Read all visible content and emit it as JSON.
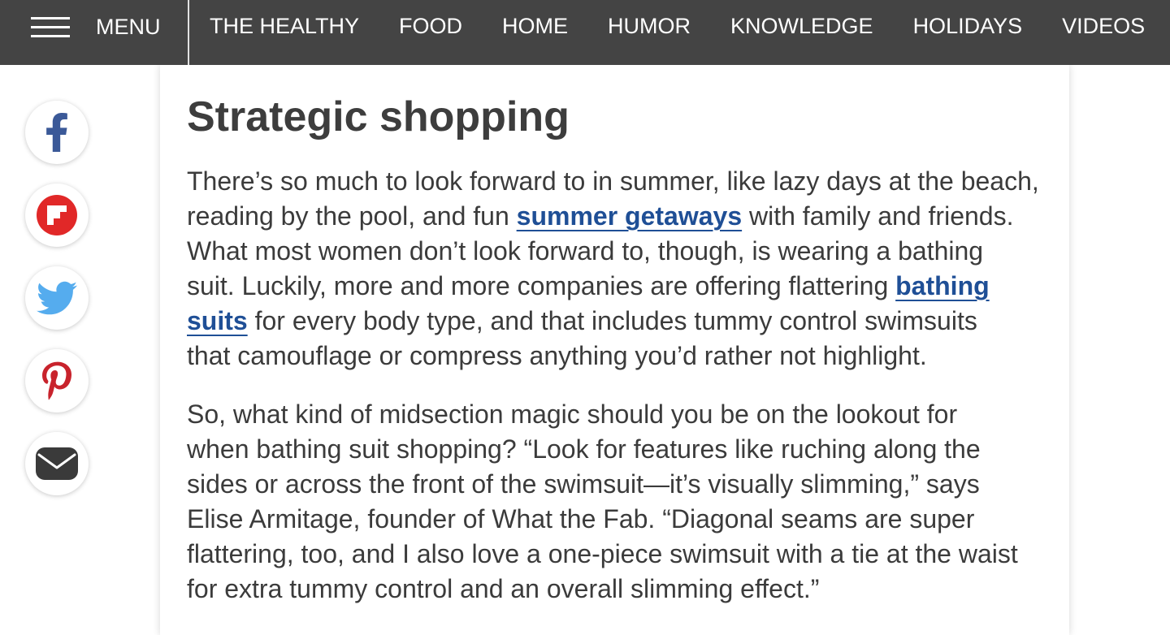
{
  "nav": {
    "menu_icon": "hamburger-icon",
    "menu_label": "MENU",
    "items": [
      "THE HEALTHY",
      "FOOD",
      "HOME",
      "HUMOR",
      "KNOWLEDGE",
      "HOLIDAYS",
      "VIDEOS"
    ]
  },
  "share_buttons": [
    {
      "icon": "facebook-icon",
      "color": "#3b5998"
    },
    {
      "icon": "flipboard-icon",
      "color": "#e12828"
    },
    {
      "icon": "twitter-icon",
      "color": "#55acee"
    },
    {
      "icon": "pinterest-icon",
      "color": "#c8232c"
    },
    {
      "icon": "email-icon",
      "color": "#3a3a3a"
    }
  ],
  "article": {
    "heading": "Strategic shopping",
    "paragraphs": [
      {
        "segments": [
          "There’s so much to look forward to in summer, like lazy days at the beach,\nreading by the pool, and fun ",
          "summer getaways",
          " with family and friends.\nWhat most women don’t look forward to, though, is wearing a bathing\nsuit. Luckily, more and more companies are offering flattering ",
          "bathing\nsuits",
          " for every body type, and that includes tummy control swimsuits\nthat camouflage or compress anything you’d rather not highlight."
        ]
      },
      {
        "segments": [
          "So, what kind of midsection magic should you be on the lookout for\nwhen bathing suit shopping? “Look for features like ruching along the\nsides or across the front of the swimsuit—it’s visually slimming,” says\nElise Armitage, founder of What the Fab. “Diagonal seams are super\nflattering, too, and I also love a one-piece swimsuit with a tie at the waist\nfor extra tummy control and an overall slimming effect.”"
        ]
      }
    ]
  },
  "colors": {
    "nav_background": "#444444",
    "nav_text": "#ffffff",
    "nav_divider": "#e2e2e2",
    "heading_text": "#3d3d3d",
    "body_text": "#3b3b3b",
    "link": "#1f4f96"
  }
}
